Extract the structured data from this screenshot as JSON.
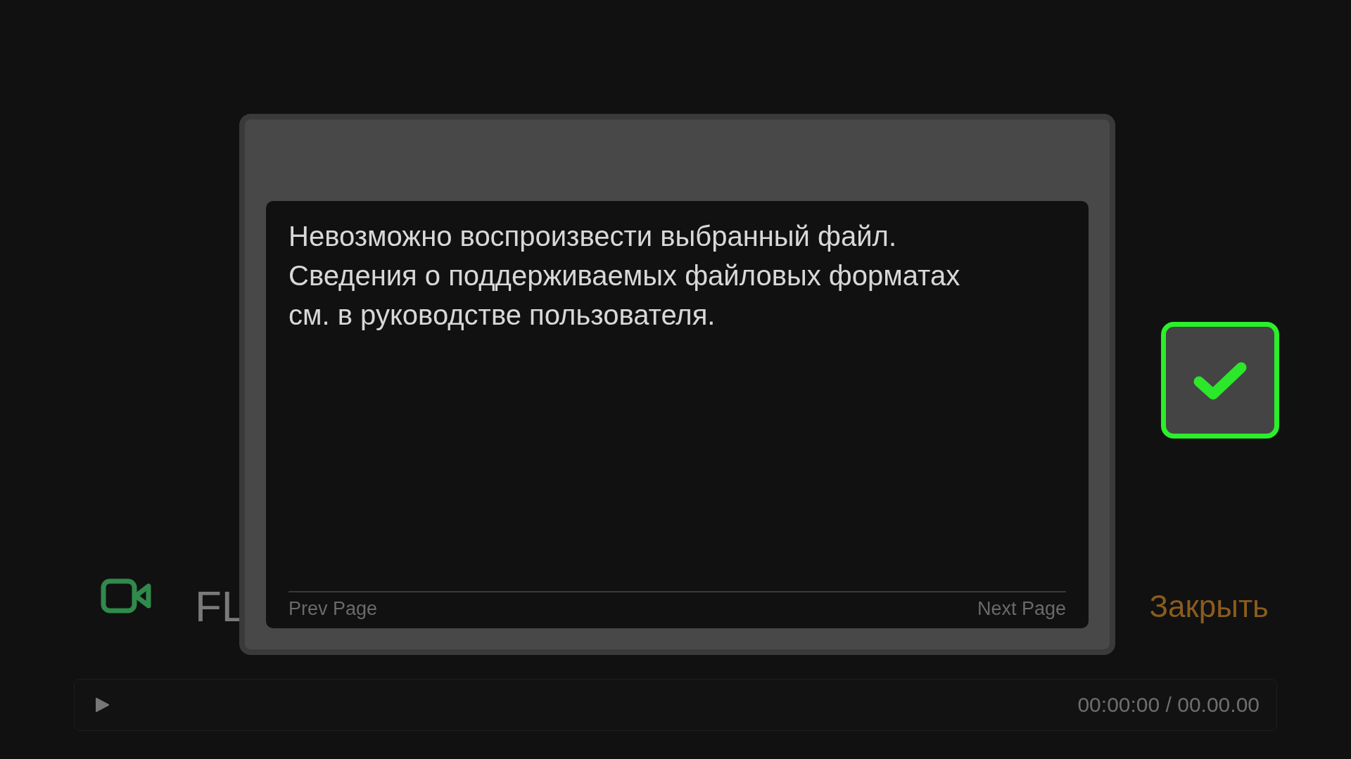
{
  "media": {
    "title": "FL",
    "close_label": "Закрыть"
  },
  "dialog": {
    "message_lines": [
      "Невозможно воспроизвести выбранный файл.",
      "Сведения о поддерживаемых файловых форматах",
      "см. в руководстве пользователя."
    ],
    "prev_page": "Prev Page",
    "next_page": "Next Page"
  },
  "confirm_button": {
    "focused": true
  },
  "player_bar": {
    "time": "00:00:00 / 00.00.00"
  }
}
